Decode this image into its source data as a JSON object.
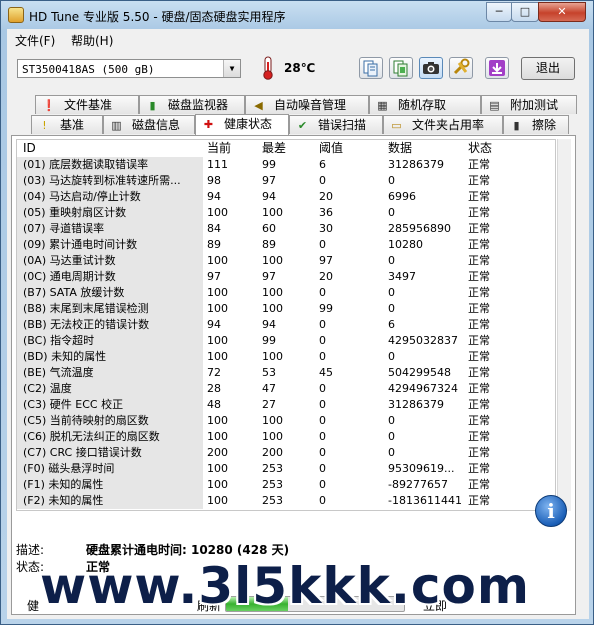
{
  "window": {
    "title": "HD Tune 专业版 5.50 - 硬盘/固态硬盘实用程序",
    "min_label": "─",
    "max_label": "□",
    "close_label": "✕"
  },
  "menu": {
    "file": "文件(F)",
    "help": "帮助(H)"
  },
  "toolbar": {
    "drive": "ST3500418AS (500 gB)",
    "temperature": "28℃",
    "exit_label": "退出",
    "icons": [
      "copy-text-icon",
      "copy-screen-icon",
      "camera-icon",
      "tools-icon",
      "save-down-icon"
    ]
  },
  "tabs_top": [
    "文件基准",
    "磁盘监视器",
    "自动噪音管理",
    "随机存取",
    "附加测试"
  ],
  "tabs_bottom": [
    "基准",
    "磁盘信息",
    "健康状态",
    "错误扫描",
    "文件夹占用率",
    "擦除"
  ],
  "active_tab": "健康状态",
  "table": {
    "headers": {
      "id": "ID",
      "current": "当前",
      "worst": "最差",
      "threshold": "阈值",
      "data": "数据",
      "status": "状态"
    },
    "rows": [
      {
        "id": "(01) 底层数据读取错误率",
        "cur": "111",
        "worst": "99",
        "thr": "6",
        "data": "31286379",
        "status": "正常"
      },
      {
        "id": "(03) 马达旋转到标准转速所需...",
        "cur": "98",
        "worst": "97",
        "thr": "0",
        "data": "0",
        "status": "正常"
      },
      {
        "id": "(04) 马达启动/停止计数",
        "cur": "94",
        "worst": "94",
        "thr": "20",
        "data": "6996",
        "status": "正常"
      },
      {
        "id": "(05) 重映射扇区计数",
        "cur": "100",
        "worst": "100",
        "thr": "36",
        "data": "0",
        "status": "正常"
      },
      {
        "id": "(07) 寻道错误率",
        "cur": "84",
        "worst": "60",
        "thr": "30",
        "data": "285956890",
        "status": "正常"
      },
      {
        "id": "(09) 累计通电时间计数",
        "cur": "89",
        "worst": "89",
        "thr": "0",
        "data": "10280",
        "status": "正常"
      },
      {
        "id": "(0A) 马达重试计数",
        "cur": "100",
        "worst": "100",
        "thr": "97",
        "data": "0",
        "status": "正常"
      },
      {
        "id": "(0C) 通电周期计数",
        "cur": "97",
        "worst": "97",
        "thr": "20",
        "data": "3497",
        "status": "正常"
      },
      {
        "id": "(B7) SATA 放缓计数",
        "cur": "100",
        "worst": "100",
        "thr": "0",
        "data": "0",
        "status": "正常"
      },
      {
        "id": "(B8) 末尾到末尾错误检测",
        "cur": "100",
        "worst": "100",
        "thr": "99",
        "data": "0",
        "status": "正常"
      },
      {
        "id": "(BB) 无法校正的错误计数",
        "cur": "94",
        "worst": "94",
        "thr": "0",
        "data": "6",
        "status": "正常"
      },
      {
        "id": "(BC) 指令超时",
        "cur": "100",
        "worst": "99",
        "thr": "0",
        "data": "4295032837",
        "status": "正常"
      },
      {
        "id": "(BD) 未知的属性",
        "cur": "100",
        "worst": "100",
        "thr": "0",
        "data": "0",
        "status": "正常"
      },
      {
        "id": "(BE) 气流温度",
        "cur": "72",
        "worst": "53",
        "thr": "45",
        "data": "504299548",
        "status": "正常"
      },
      {
        "id": "(C2) 温度",
        "cur": "28",
        "worst": "47",
        "thr": "0",
        "data": "4294967324",
        "status": "正常"
      },
      {
        "id": "(C3) 硬件 ECC 校正",
        "cur": "48",
        "worst": "27",
        "thr": "0",
        "data": "31286379",
        "status": "正常"
      },
      {
        "id": "(C5) 当前待映射的扇区数",
        "cur": "100",
        "worst": "100",
        "thr": "0",
        "data": "0",
        "status": "正常"
      },
      {
        "id": "(C6) 脱机无法纠正的扇区数",
        "cur": "100",
        "worst": "100",
        "thr": "0",
        "data": "0",
        "status": "正常"
      },
      {
        "id": "(C7) CRC 接口错误计数",
        "cur": "200",
        "worst": "200",
        "thr": "0",
        "data": "0",
        "status": "正常"
      },
      {
        "id": "(F0) 磁头悬浮时间",
        "cur": "100",
        "worst": "253",
        "thr": "0",
        "data": "95309619...",
        "status": "正常"
      },
      {
        "id": "(F1) 未知的属性",
        "cur": "100",
        "worst": "253",
        "thr": "0",
        "data": "-89277657",
        "status": "正常"
      },
      {
        "id": "(F2) 未知的属性",
        "cur": "100",
        "worst": "253",
        "thr": "0",
        "data": "-1813611441",
        "status": "正常"
      }
    ]
  },
  "details": {
    "desc_label": "描述:",
    "desc_value": "硬盘累计通电时间: 10280 (428 天)",
    "status_label": "状态:",
    "status_value": "正常"
  },
  "bottom": {
    "left_label": "健",
    "refresh_label": "刷新",
    "now_label": "立即",
    "progress_fraction": 0.35
  },
  "watermark": "www.3l5kkk.com"
}
